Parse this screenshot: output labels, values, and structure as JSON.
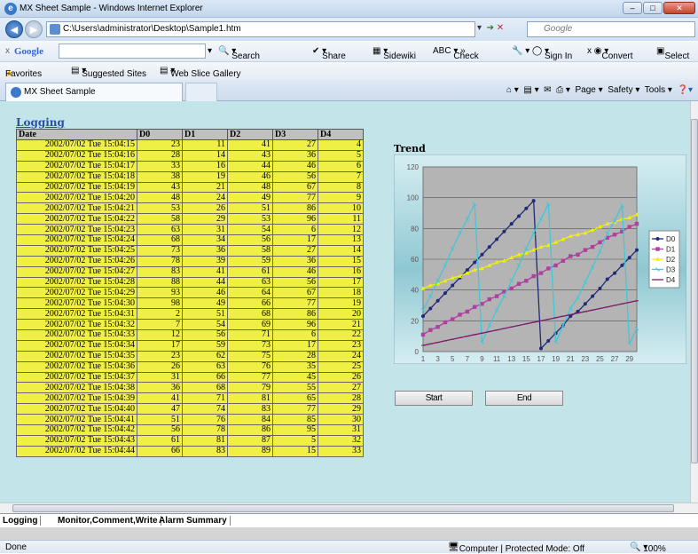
{
  "window": {
    "title": "MX Sheet Sample - Windows Internet Explorer"
  },
  "address": {
    "url": "C:\\Users\\administrator\\Desktop\\Sample1.htm",
    "search_placeholder": "Google"
  },
  "google_bar": {
    "logo": "Google",
    "search": "Search",
    "share": "Share",
    "sidewiki": "Sidewiki",
    "check": "Check",
    "signin": "Sign In",
    "convert": "Convert",
    "select": "Select"
  },
  "favorites": {
    "label": "Favorites",
    "suggested": "Suggested Sites",
    "webslice": "Web Slice Gallery"
  },
  "tab": {
    "label": "MX Sheet Sample"
  },
  "command_bar": {
    "page": "Page",
    "safety": "Safety",
    "tools": "Tools"
  },
  "sheet": {
    "heading": "Logging",
    "columns": [
      "Date",
      "D0",
      "D1",
      "D2",
      "D3",
      "D4"
    ],
    "rows": [
      [
        "2002/07/02 Tue 15:04:15",
        "23",
        "11",
        "41",
        "27",
        "4"
      ],
      [
        "2002/07/02 Tue 15:04:16",
        "28",
        "14",
        "43",
        "36",
        "5"
      ],
      [
        "2002/07/02 Tue 15:04:17",
        "33",
        "16",
        "44",
        "46",
        "6"
      ],
      [
        "2002/07/02 Tue 15:04:18",
        "38",
        "19",
        "46",
        "56",
        "7"
      ],
      [
        "2002/07/02 Tue 15:04:19",
        "43",
        "21",
        "48",
        "67",
        "8"
      ],
      [
        "2002/07/02 Tue 15:04:20",
        "48",
        "24",
        "49",
        "77",
        "9"
      ],
      [
        "2002/07/02 Tue 15:04:21",
        "53",
        "26",
        "51",
        "86",
        "10"
      ],
      [
        "2002/07/02 Tue 15:04:22",
        "58",
        "29",
        "53",
        "96",
        "11"
      ],
      [
        "2002/07/02 Tue 15:04:23",
        "63",
        "31",
        "54",
        "6",
        "12"
      ],
      [
        "2002/07/02 Tue 15:04:24",
        "68",
        "34",
        "56",
        "17",
        "13"
      ],
      [
        "2002/07/02 Tue 15:04:25",
        "73",
        "36",
        "58",
        "27",
        "14"
      ],
      [
        "2002/07/02 Tue 15:04:26",
        "78",
        "39",
        "59",
        "36",
        "15"
      ],
      [
        "2002/07/02 Tue 15:04:27",
        "83",
        "41",
        "61",
        "46",
        "16"
      ],
      [
        "2002/07/02 Tue 15:04:28",
        "88",
        "44",
        "63",
        "56",
        "17"
      ],
      [
        "2002/07/02 Tue 15:04:29",
        "93",
        "46",
        "64",
        "67",
        "18"
      ],
      [
        "2002/07/02 Tue 15:04:30",
        "98",
        "49",
        "66",
        "77",
        "19"
      ],
      [
        "2002/07/02 Tue 15:04:31",
        "2",
        "51",
        "68",
        "86",
        "20"
      ],
      [
        "2002/07/02 Tue 15:04:32",
        "7",
        "54",
        "69",
        "96",
        "21"
      ],
      [
        "2002/07/02 Tue 15:04:33",
        "12",
        "56",
        "71",
        "6",
        "22"
      ],
      [
        "2002/07/02 Tue 15:04:34",
        "17",
        "59",
        "73",
        "17",
        "23"
      ],
      [
        "2002/07/02 Tue 15:04:35",
        "23",
        "62",
        "75",
        "28",
        "24"
      ],
      [
        "2002/07/02 Tue 15:04:36",
        "26",
        "63",
        "76",
        "35",
        "25"
      ],
      [
        "2002/07/02 Tue 15:04:37",
        "31",
        "66",
        "77",
        "45",
        "26"
      ],
      [
        "2002/07/02 Tue 15:04:38",
        "36",
        "68",
        "79",
        "55",
        "27"
      ],
      [
        "2002/07/02 Tue 15:04:39",
        "41",
        "71",
        "81",
        "65",
        "28"
      ],
      [
        "2002/07/02 Tue 15:04:40",
        "47",
        "74",
        "83",
        "77",
        "29"
      ],
      [
        "2002/07/02 Tue 15:04:41",
        "51",
        "76",
        "84",
        "85",
        "30"
      ],
      [
        "2002/07/02 Tue 15:04:42",
        "56",
        "78",
        "86",
        "95",
        "31"
      ],
      [
        "2002/07/02 Tue 15:04:43",
        "61",
        "81",
        "87",
        "5",
        "32"
      ],
      [
        "2002/07/02 Tue 15:04:44",
        "66",
        "83",
        "89",
        "15",
        "33"
      ]
    ]
  },
  "trend": {
    "title": "Trend",
    "start_label": "Start",
    "end_label": "End"
  },
  "chart_data": {
    "type": "line",
    "title": "Trend",
    "x": [
      1,
      2,
      3,
      4,
      5,
      6,
      7,
      8,
      9,
      10,
      11,
      12,
      13,
      14,
      15,
      16,
      17,
      18,
      19,
      20,
      21,
      22,
      23,
      24,
      25,
      26,
      27,
      28,
      29,
      30
    ],
    "x_tick_labels": [
      "1",
      "3",
      "5",
      "7",
      "9",
      "11",
      "13",
      "15",
      "17",
      "19",
      "21",
      "23",
      "25",
      "27",
      "29"
    ],
    "ylim": [
      0,
      120
    ],
    "y_ticks": [
      0,
      20,
      40,
      60,
      80,
      100,
      120
    ],
    "grid": true,
    "legend": "right",
    "series": [
      {
        "name": "D0",
        "color": "#1f2a7a",
        "values": [
          23,
          28,
          33,
          38,
          43,
          48,
          53,
          58,
          63,
          68,
          73,
          78,
          83,
          88,
          93,
          98,
          2,
          7,
          12,
          17,
          23,
          26,
          31,
          36,
          41,
          47,
          51,
          56,
          61,
          66
        ]
      },
      {
        "name": "D1",
        "color": "#b040a0",
        "values": [
          11,
          14,
          16,
          19,
          21,
          24,
          26,
          29,
          31,
          34,
          36,
          39,
          41,
          44,
          46,
          49,
          51,
          54,
          56,
          59,
          62,
          63,
          66,
          68,
          71,
          74,
          76,
          78,
          81,
          83
        ]
      },
      {
        "name": "D2",
        "color": "#f0f000",
        "values": [
          41,
          43,
          44,
          46,
          48,
          49,
          51,
          53,
          54,
          56,
          58,
          59,
          61,
          63,
          64,
          66,
          68,
          69,
          71,
          73,
          75,
          76,
          77,
          79,
          81,
          83,
          84,
          86,
          87,
          89
        ]
      },
      {
        "name": "D3",
        "color": "#40c8d8",
        "values": [
          27,
          36,
          46,
          56,
          67,
          77,
          86,
          96,
          6,
          17,
          27,
          36,
          46,
          56,
          67,
          77,
          86,
          96,
          6,
          17,
          28,
          35,
          45,
          55,
          65,
          77,
          85,
          95,
          5,
          15
        ]
      },
      {
        "name": "D4",
        "color": "#7a1a6a",
        "values": [
          4,
          5,
          6,
          7,
          8,
          9,
          10,
          11,
          12,
          13,
          14,
          15,
          16,
          17,
          18,
          19,
          20,
          21,
          22,
          23,
          24,
          25,
          26,
          27,
          28,
          29,
          30,
          31,
          32,
          33
        ]
      }
    ]
  },
  "sheet_tabs": [
    "Logging",
    "Monitor,Comment,Write",
    "Alarm Summary"
  ],
  "status": {
    "left": "Done",
    "zone": "Computer | Protected Mode: Off",
    "zoom": "100%"
  }
}
